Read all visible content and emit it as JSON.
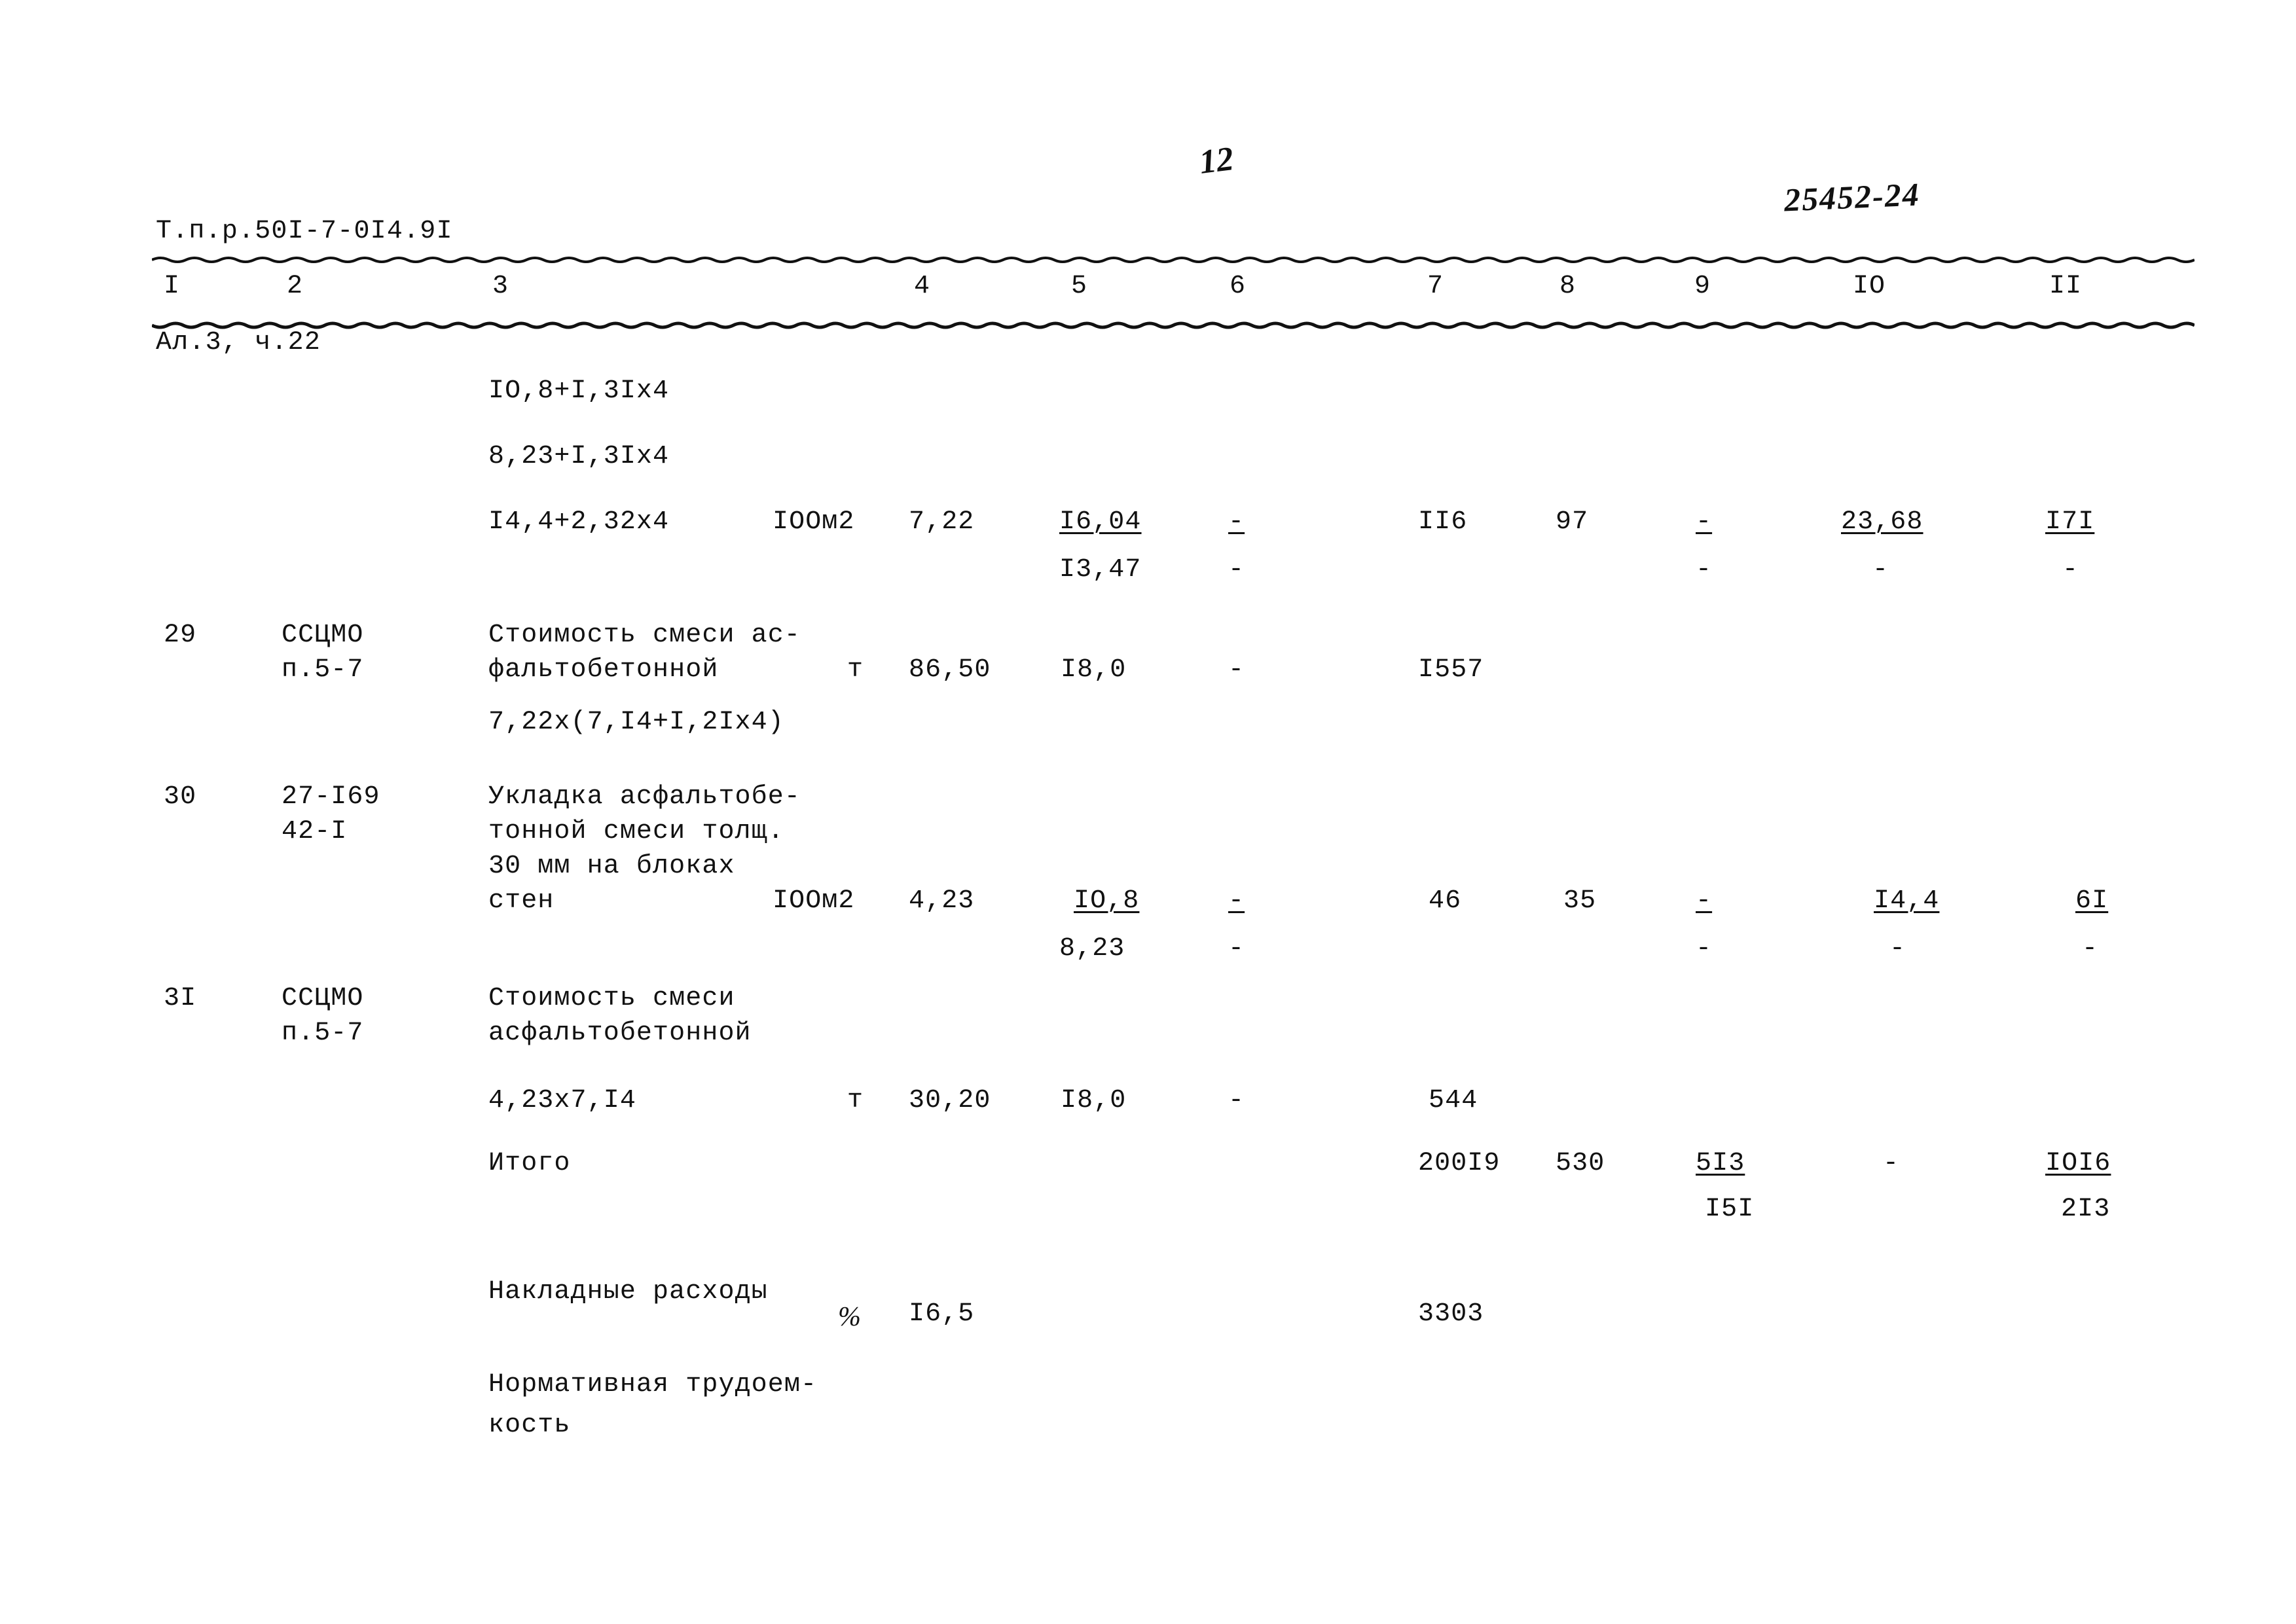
{
  "header": {
    "doc_code_line1": "Т.п.р.50I-7-0I4.9I",
    "doc_code_line2": "Ал.3, ч.22",
    "page_number_handwritten": "12",
    "archive_stamp_handwritten": "25452-24"
  },
  "table": {
    "column_headers": [
      "I",
      "2",
      "3",
      "4",
      "5",
      "6",
      "7",
      "8",
      "9",
      "IO",
      "II"
    ],
    "rows": [
      {
        "num": "",
        "code": "",
        "desc_lines": [
          "IO,8+I,3Ix4"
        ],
        "unit": "",
        "c4": "",
        "c5": "",
        "c5b": "",
        "c6": "",
        "c6b": "",
        "c7": "",
        "c8": "",
        "c9": "",
        "c9b": "",
        "c10": "",
        "c10b": "",
        "c11": "",
        "c11b": ""
      },
      {
        "num": "",
        "code": "",
        "desc_lines": [
          "8,23+I,3Ix4"
        ],
        "unit": "",
        "c4": "",
        "c5": "",
        "c5b": "",
        "c6": "",
        "c6b": "",
        "c7": "",
        "c8": "",
        "c9": "",
        "c9b": "",
        "c10": "",
        "c10b": "",
        "c11": "",
        "c11b": ""
      },
      {
        "num": "",
        "code": "",
        "desc_lines": [
          "I4,4+2,32x4"
        ],
        "unit": "IOOм2",
        "c4": "7,22",
        "c5": "I6,04",
        "c5b": "I3,47",
        "c6": "-",
        "c6b": "-",
        "c7": "II6",
        "c8": "97",
        "c9": "-",
        "c9b": "-",
        "c10": "23,68",
        "c10b": "-",
        "c11": "I7I",
        "c11b": "-"
      },
      {
        "num": "29",
        "code_lines": [
          "ССЦМО",
          "п.5-7"
        ],
        "desc_lines": [
          "Стоимость смеси ас-",
          "фальтобетонной"
        ],
        "unit": "т",
        "c4": "86,50",
        "c5": "I8,0",
        "c5b": "",
        "c6": "-",
        "c6b": "",
        "c7": "I557",
        "c8": "",
        "c9": "",
        "c9b": "",
        "c10": "",
        "c10b": "",
        "c11": "",
        "c11b": ""
      },
      {
        "num": "",
        "code": "",
        "desc_lines": [
          "7,22x(7,I4+I,2Ix4)"
        ],
        "unit": "",
        "c4": "",
        "c5": "",
        "c5b": "",
        "c6": "",
        "c6b": "",
        "c7": "",
        "c8": "",
        "c9": "",
        "c9b": "",
        "c10": "",
        "c10b": "",
        "c11": "",
        "c11b": ""
      },
      {
        "num": "30",
        "code_lines": [
          "27-I69",
          "42-I"
        ],
        "desc_lines": [
          "Укладка асфальтобе-",
          "тонной смеси толщ.",
          "30 мм на блоках",
          "стен"
        ],
        "unit": "IOOм2",
        "c4": "4,23",
        "c5": "IO,8",
        "c5b": "8,23",
        "c6": "-",
        "c6b": "-",
        "c7": "46",
        "c8": "35",
        "c9": "-",
        "c9b": "-",
        "c10": "I4,4",
        "c10b": "-",
        "c11": "6I",
        "c11b": "-"
      },
      {
        "num": "3I",
        "code_lines": [
          "ССЦМО",
          "п.5-7"
        ],
        "desc_lines": [
          "Стоимость смеси",
          "асфальтобетонной"
        ],
        "unit": "",
        "c4": "",
        "c5": "",
        "c5b": "",
        "c6": "",
        "c6b": "",
        "c7": "",
        "c8": "",
        "c9": "",
        "c9b": "",
        "c10": "",
        "c10b": "",
        "c11": "",
        "c11b": ""
      },
      {
        "num": "",
        "code": "",
        "desc_lines": [
          "4,23x7,I4"
        ],
        "unit": "т",
        "c4": "30,20",
        "c5": "I8,0",
        "c5b": "",
        "c6": "-",
        "c6b": "",
        "c7": "544",
        "c8": "",
        "c9": "",
        "c9b": "",
        "c10": "",
        "c10b": "",
        "c11": "",
        "c11b": ""
      },
      {
        "num": "",
        "code": "",
        "desc_lines": [
          "Итого"
        ],
        "unit": "",
        "c4": "",
        "c5": "",
        "c5b": "",
        "c6": "",
        "c6b": "",
        "c7": "200I9",
        "c8": "530",
        "c9": "5I3",
        "c9b": "I5I",
        "c10": "-",
        "c10b": "",
        "c11": "IOI6",
        "c11b": "2I3"
      },
      {
        "num": "",
        "code": "",
        "desc_lines": [
          "Накладные расходы"
        ],
        "unit": "%",
        "c4": "I6,5",
        "c5": "",
        "c5b": "",
        "c6": "",
        "c6b": "",
        "c7": "3303",
        "c8": "",
        "c9": "",
        "c9b": "",
        "c10": "",
        "c10b": "",
        "c11": "",
        "c11b": ""
      },
      {
        "num": "",
        "code": "",
        "desc_lines": [
          "Нормативная трудоем-",
          "кость"
        ],
        "unit": "",
        "c4": "",
        "c5": "",
        "c5b": "",
        "c6": "",
        "c6b": "",
        "c7": "",
        "c8": "",
        "c9": "",
        "c9b": "",
        "c10": "",
        "c10b": "",
        "c11": "",
        "c11b": ""
      }
    ]
  },
  "cells": {
    "r1_desc": "IO,8+I,3Ix4",
    "r2_desc": "8,23+I,3Ix4",
    "r3_desc": "I4,4+2,32x4",
    "r3_unit": "IOOм2",
    "r3_c4": "7,22",
    "r3_c5": "I6,04",
    "r3_c5b": "I3,47",
    "r3_c6": "-",
    "r3_c6b": "-",
    "r3_c7": "II6",
    "r3_c8": "97",
    "r3_c9": "-",
    "r3_c9b": "-",
    "r3_c10": "23,68",
    "r3_c10b": "-",
    "r3_c11": "I7I",
    "r3_c11b": "-",
    "r29_num": "29",
    "r29_code1": "ССЦМО",
    "r29_code2": "п.5-7",
    "r29_desc1": "Стоимость смеси ас-",
    "r29_desc2": "фальтобетонной",
    "r29_unit": "т",
    "r29_c4": "86,50",
    "r29_c5": "I8,0",
    "r29_c6": "-",
    "r29_c7": "I557",
    "r29_formula": "7,22x(7,I4+I,2Ix4)",
    "r30_num": "30",
    "r30_code1": "27-I69",
    "r30_code2": "42-I",
    "r30_desc1": "Укладка асфальтобе-",
    "r30_desc2": "тонной смеси толщ.",
    "r30_desc3": "30 мм на блоках",
    "r30_desc4": "стен",
    "r30_unit": "IOOм2",
    "r30_c4": "4,23",
    "r30_c5": "IO,8",
    "r30_c5b": "8,23",
    "r30_c6": "-",
    "r30_c6b": "-",
    "r30_c7": "46",
    "r30_c8": "35",
    "r30_c9": "-",
    "r30_c9b": "-",
    "r30_c10": "I4,4",
    "r30_c10b": "-",
    "r30_c11": "6I",
    "r30_c11b": "-",
    "r31_num": "3I",
    "r31_code1": "ССЦМО",
    "r31_code2": "п.5-7",
    "r31_desc1": "Стоимость смеси",
    "r31_desc2": "асфальтобетонной",
    "r31_formula": "4,23x7,I4",
    "r31_unit": "т",
    "r31_c4": "30,20",
    "r31_c5": "I8,0",
    "r31_c6": "-",
    "r31_c7": "544",
    "total_label": "Итого",
    "total_c7": "200I9",
    "total_c8": "530",
    "total_c9": "5I3",
    "total_c9b": "I5I",
    "total_c10": "-",
    "total_c11": "IOI6",
    "total_c11b": "2I3",
    "overhead_label": "Накладные расходы",
    "overhead_unit": "%",
    "overhead_c4": "I6,5",
    "overhead_c7": "3303",
    "labor_label1": "Нормативная трудоем-",
    "labor_label2": "кость"
  }
}
